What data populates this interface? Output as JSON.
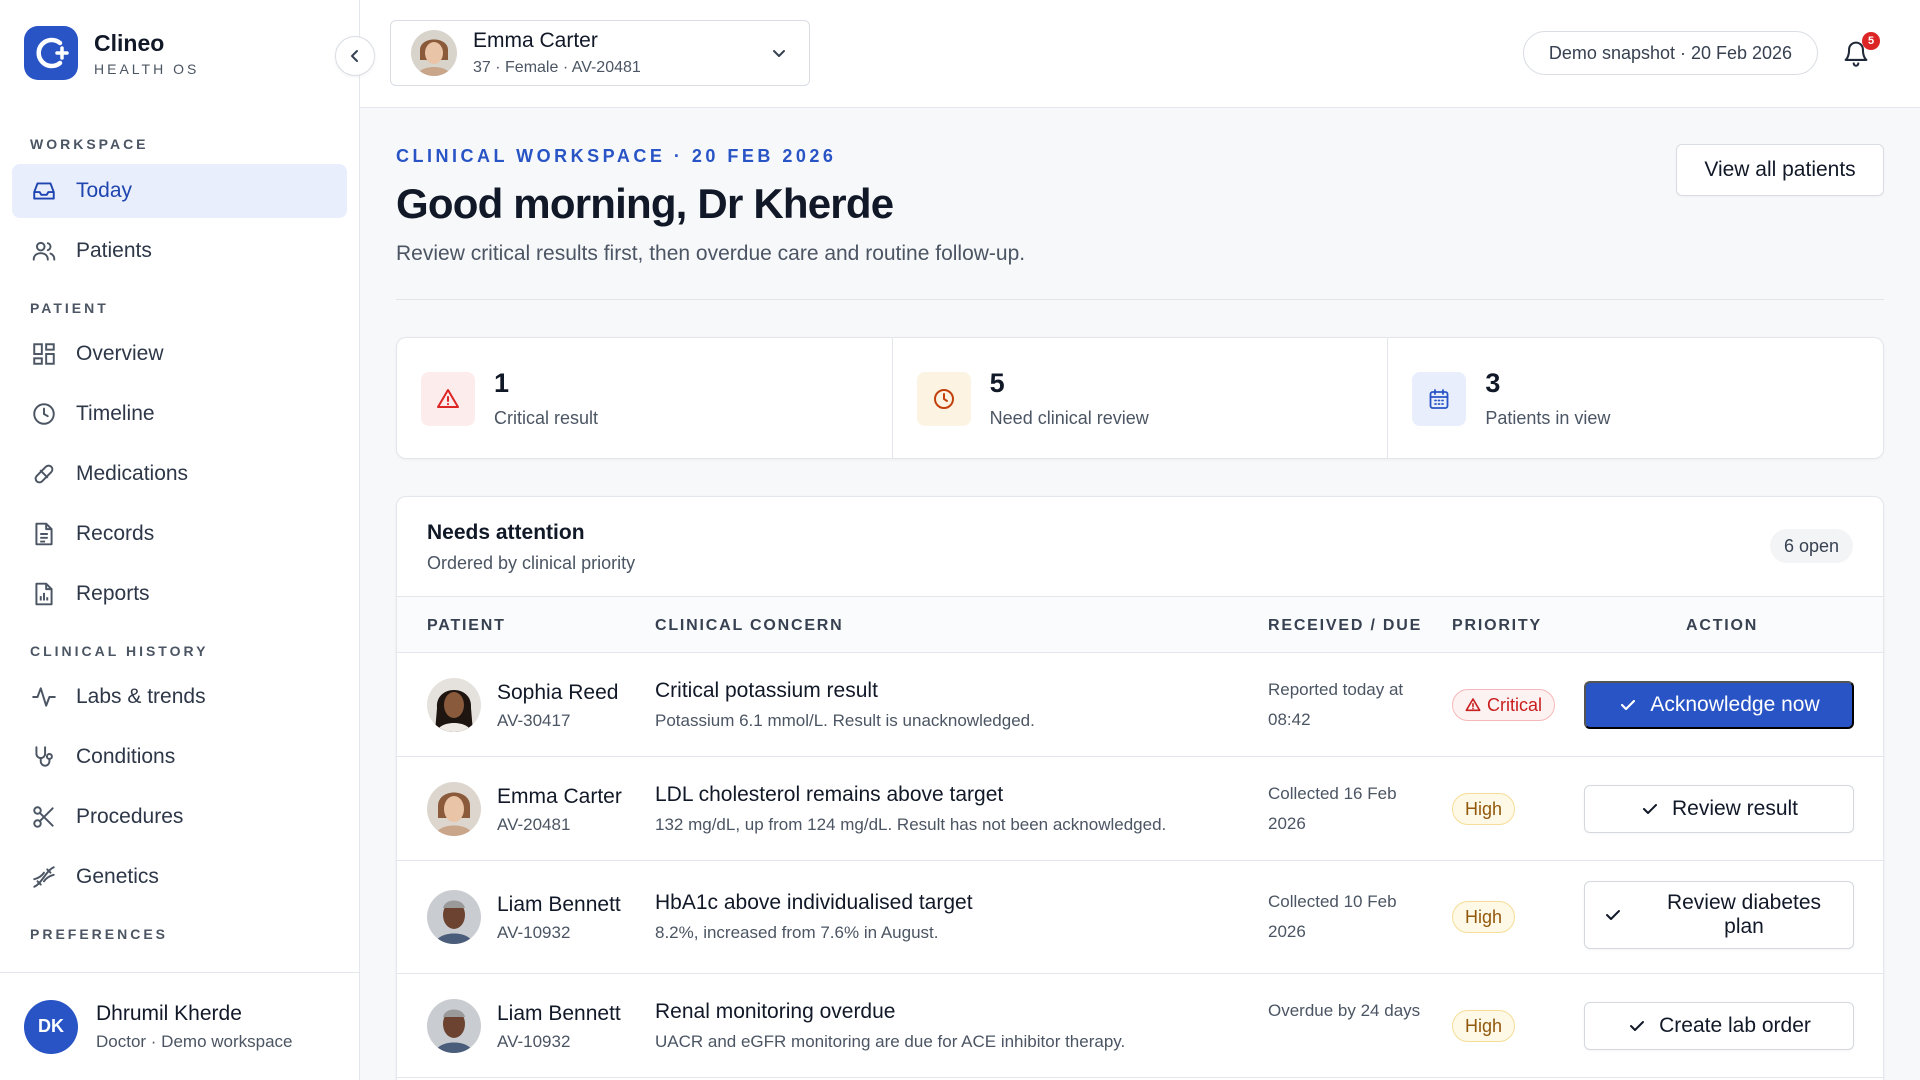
{
  "brand": {
    "name": "Clineo",
    "sub": "HEALTH OS",
    "color": "#2854c5"
  },
  "sidebar": {
    "sections": {
      "workspace": "WORKSPACE",
      "patient": "PATIENT",
      "clinical_history": "CLINICAL HISTORY",
      "preferences": "PREFERENCES"
    },
    "items": [
      {
        "label": "Today",
        "icon": "inbox-icon",
        "active": true
      },
      {
        "label": "Patients",
        "icon": "users-icon"
      },
      {
        "label": "Overview",
        "icon": "grid-icon"
      },
      {
        "label": "Timeline",
        "icon": "clock-icon"
      },
      {
        "label": "Medications",
        "icon": "pill-icon"
      },
      {
        "label": "Records",
        "icon": "document-icon"
      },
      {
        "label": "Reports",
        "icon": "report-icon"
      },
      {
        "label": "Labs & trends",
        "icon": "activity-icon"
      },
      {
        "label": "Conditions",
        "icon": "stethoscope-icon"
      },
      {
        "label": "Procedures",
        "icon": "scissors-icon"
      },
      {
        "label": "Genetics",
        "icon": "dna-icon"
      }
    ],
    "user": {
      "initials": "DK",
      "name": "Dhrumil Kherde",
      "role": "Doctor · Demo workspace"
    }
  },
  "header": {
    "patient": {
      "name": "Emma Carter",
      "meta": "37 · Female · AV-20481"
    },
    "snapshot": "Demo snapshot · 20 Feb 2026",
    "notifications": "5"
  },
  "main": {
    "eyebrow": "CLINICAL WORKSPACE · 20 FEB 2026",
    "greeting": "Good morning, Dr Kherde",
    "subline": "Review critical results first, then overdue care and routine follow-up.",
    "view_all": "View all patients",
    "stats": [
      {
        "value": "1",
        "label": "Critical result",
        "icon": "alert-triangle-icon",
        "color": "#dc2626"
      },
      {
        "value": "5",
        "label": "Need clinical review",
        "icon": "clock-icon",
        "color": "#c2410c"
      },
      {
        "value": "3",
        "label": "Patients in view",
        "icon": "calendar-icon",
        "color": "#2854c5"
      }
    ],
    "attention": {
      "title": "Needs attention",
      "subtitle": "Ordered by clinical priority",
      "count": "6 open",
      "columns": [
        "PATIENT",
        "CLINICAL CONCERN",
        "RECEIVED / DUE",
        "PRIORITY",
        "ACTION"
      ],
      "rows": [
        {
          "name": "Sophia Reed",
          "id": "AV-30417",
          "concern": "Critical potassium result",
          "detail": "Potassium 6.1 mmol/L. Result is unacknowledged.",
          "date": "Reported today at 08:42",
          "priority": "Critical",
          "action": "Acknowledge now"
        },
        {
          "name": "Emma Carter",
          "id": "AV-20481",
          "concern": "LDL cholesterol remains above target",
          "detail": "132 mg/dL, up from 124 mg/dL. Result has not been acknowledged.",
          "date": "Collected 16 Feb 2026",
          "priority": "High",
          "action": "Review result"
        },
        {
          "name": "Liam Bennett",
          "id": "AV-10932",
          "concern": "HbA1c above individualised target",
          "detail": "8.2%, increased from 7.6% in August.",
          "date": "Collected 10 Feb 2026",
          "priority": "High",
          "action": "Review diabetes plan"
        },
        {
          "name": "Liam Bennett",
          "id": "AV-10932",
          "concern": "Renal monitoring overdue",
          "detail": "UACR and eGFR monitoring are due for ACE inhibitor therapy.",
          "date": "Overdue by 24 days",
          "priority": "High",
          "action": "Create lab order"
        }
      ]
    }
  }
}
